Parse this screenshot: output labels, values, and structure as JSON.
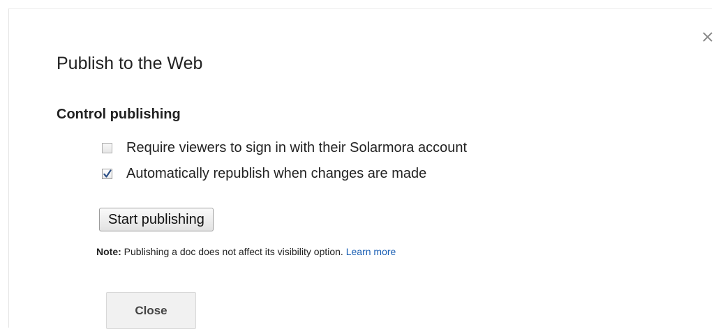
{
  "dialog": {
    "title": "Publish to the Web",
    "close_icon": "close-x-icon",
    "section_heading": "Control publishing",
    "options": [
      {
        "label": "Require viewers to sign in with their Solarmora account",
        "checked": false
      },
      {
        "label": "Automatically republish when changes are made",
        "checked": true
      }
    ],
    "start_button_label": "Start publishing",
    "note": {
      "prefix": "Note:",
      "text": " Publishing a doc does not affect its visibility option. ",
      "link": "Learn more"
    },
    "close_button_label": "Close"
  },
  "colors": {
    "link": "#1a5fb4",
    "text": "#222222",
    "close_button_bg": "#f1f1f1"
  }
}
